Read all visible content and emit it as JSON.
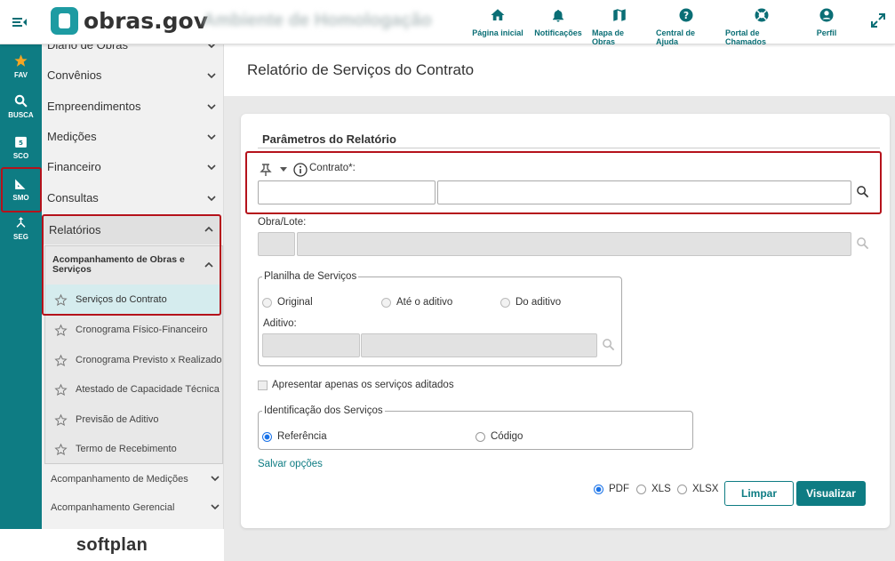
{
  "topbar": {
    "logo_text": "obras.gov",
    "environment": "Ambiente de Homologação",
    "nav": [
      {
        "label": "Página inicial",
        "icon": "home-icon"
      },
      {
        "label": "Notificações",
        "icon": "bell-icon"
      },
      {
        "label": "Mapa de Obras",
        "icon": "map-icon"
      },
      {
        "label": "Central de Ajuda",
        "icon": "help-icon"
      },
      {
        "label": "Portal de Chamados",
        "icon": "lifebuoy-icon"
      },
      {
        "label": "Perfil",
        "icon": "user-icon"
      }
    ]
  },
  "rail": {
    "items": [
      {
        "label": "FAV",
        "icon": "star-icon"
      },
      {
        "label": "BUSCA",
        "icon": "search-icon"
      },
      {
        "label": "SCO",
        "icon": "calendar-icon"
      },
      {
        "label": "SMO",
        "icon": "ruler-icon"
      },
      {
        "label": "SEG",
        "icon": "merge-icon"
      }
    ]
  },
  "sidebar": {
    "top_partial": "Diário de Obras",
    "menus": [
      "Convênios",
      "Empreendimentos",
      "Medições",
      "Financeiro",
      "Consultas"
    ],
    "relatorios": "Relatórios",
    "submenu_title": "Acompanhamento de Obras e Serviços",
    "sub_items": [
      "Serviços do Contrato",
      "Cronograma Físico-Financeiro",
      "Cronograma Previsto x Realizado",
      "Atestado de Capacidade Técnica",
      "Previsão de Aditivo",
      "Termo de Recebimento"
    ],
    "lower_menus": [
      "Acompanhamento de Medições",
      "Acompanhamento Gerencial"
    ],
    "brand": "softplan"
  },
  "main": {
    "page_title": "Relatório de Serviços do Contrato",
    "section_title": "Parâmetros do Relatório",
    "contrato_label": "Contrato*:",
    "contrato_code": "",
    "contrato_desc": "",
    "obra_label": "Obra/Lote:",
    "planilha_legend": "Planilha de Serviços",
    "planilha_options": [
      "Original",
      "Até o aditivo",
      "Do aditivo"
    ],
    "aditivo_label": "Aditivo:",
    "apresentar_label": "Apresentar apenas os serviços aditados",
    "identificacao_legend": "Identificação dos Serviços",
    "identificacao_options": [
      "Referência",
      "Código"
    ],
    "identificacao_selected": "Referência",
    "salvar_opcoes": "Salvar opções",
    "formats": [
      "PDF",
      "XLS",
      "XLSX"
    ],
    "format_selected": "PDF",
    "limpar": "Limpar",
    "visualizar": "Visualizar"
  },
  "colors": {
    "teal": "#0e7c83",
    "highlight": "#b5121b"
  }
}
